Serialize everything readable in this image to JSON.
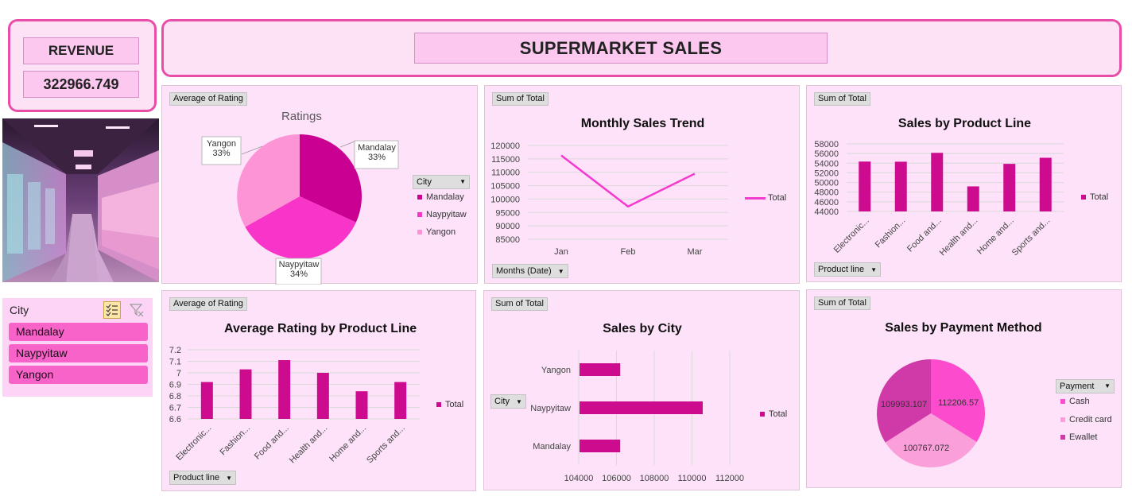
{
  "revenue": {
    "label": "REVENUE",
    "value": "322966.749"
  },
  "title": "SUPERMARKET SALES",
  "slicer": {
    "title": "City",
    "items": [
      "Mandalay",
      "Naypyitaw",
      "Yangon"
    ],
    "multi_select_icon": "multi-select-icon",
    "clear_filter_icon": "clear-filter-icon"
  },
  "ratings_pie": {
    "field_button": "Average of Rating",
    "title": "Ratings",
    "legend_field": "City",
    "labels": [
      {
        "name": "Mandalay",
        "pct": "33%"
      },
      {
        "name": "Naypyitaw",
        "pct": "34%"
      },
      {
        "name": "Yangon",
        "pct": "33%"
      }
    ]
  },
  "monthly_trend": {
    "field_button": "Sum of Total",
    "title": "Monthly Sales Trend",
    "axis_field": "Months (Date)",
    "legend": "Total"
  },
  "product_line_sales": {
    "field_button": "Sum of Total",
    "title": "Sales by Product Line",
    "axis_field": "Product line",
    "legend": "Total"
  },
  "avg_rating_product": {
    "field_button": "Average of Rating",
    "title": "Average Rating by Product Line",
    "axis_field": "Product line",
    "legend": "Total"
  },
  "city_sales": {
    "field_button": "Sum of Total",
    "title": "Sales by City",
    "axis_field": "City",
    "legend": "Total"
  },
  "payment_sales": {
    "field_button": "Sum of Total",
    "title": "Sales by Payment Method",
    "legend_field": "Payment",
    "labels": [
      "112206.57",
      "100767.072",
      "109993.107"
    ]
  },
  "colors": {
    "accent": "#e84ea8",
    "bar": "#cc0b8f",
    "pie_mandalay": "#c90091",
    "pie_naypyitaw": "#f934c8",
    "pie_yangon": "#fc94d6",
    "line": "#f43bd0"
  },
  "chart_data": [
    {
      "type": "pie",
      "title": "Ratings",
      "categories": [
        "Mandalay",
        "Naypyitaw",
        "Yangon"
      ],
      "values": [
        33,
        34,
        33
      ],
      "legend": "right"
    },
    {
      "type": "line",
      "title": "Monthly Sales Trend",
      "categories": [
        "Jan",
        "Feb",
        "Mar"
      ],
      "series": [
        {
          "name": "Total",
          "values": [
            116291.868,
            97219.374,
            109455.507
          ]
        }
      ],
      "yticks": [
        "85000",
        "90000",
        "95000",
        "100000",
        "105000",
        "110000",
        "115000",
        "120000"
      ],
      "ylim": [
        85000,
        120000
      ],
      "grid": true,
      "legend": "right"
    },
    {
      "type": "bar",
      "title": "Sales by Product Line",
      "categories": [
        "Electronic...",
        "Fashion...",
        "Food and...",
        "Health and...",
        "Home and...",
        "Sports and..."
      ],
      "series": [
        {
          "name": "Total",
          "values": [
            54337.5315,
            54305.895,
            56144.844,
            49193.739,
            53861.913,
            55122.8265
          ]
        }
      ],
      "yticks": [
        "44000",
        "46000",
        "48000",
        "50000",
        "52000",
        "54000",
        "56000",
        "58000"
      ],
      "ylim": [
        44000,
        58000
      ],
      "grid": true,
      "legend": "right"
    },
    {
      "type": "bar",
      "title": "Average Rating by Product Line",
      "categories": [
        "Electronic...",
        "Fashion...",
        "Food and...",
        "Health and...",
        "Home and...",
        "Sports and..."
      ],
      "series": [
        {
          "name": "Total",
          "values": [
            6.92,
            7.03,
            7.11,
            7.0,
            6.84,
            6.92
          ]
        }
      ],
      "yticks": [
        "6.6",
        "6.7",
        "6.8",
        "6.9",
        "7",
        "7.1",
        "7.2"
      ],
      "ylim": [
        6.6,
        7.2
      ],
      "grid": true,
      "legend": "right"
    },
    {
      "type": "bar",
      "title": "Sales by City",
      "orientation": "horizontal",
      "categories": [
        "Yangon",
        "Naypyitaw",
        "Mandalay"
      ],
      "series": [
        {
          "name": "Total",
          "values": [
            106200.3705,
            110568.7065,
            106197.672
          ]
        }
      ],
      "xticks": [
        "104000",
        "106000",
        "108000",
        "110000",
        "112000"
      ],
      "xlim": [
        104000,
        112000
      ],
      "grid": true,
      "legend": "right"
    },
    {
      "type": "pie",
      "title": "Sales by Payment Method",
      "categories": [
        "Cash",
        "Credit card",
        "Ewallet"
      ],
      "values": [
        112206.57,
        100767.072,
        109993.107
      ],
      "legend": "right"
    }
  ]
}
